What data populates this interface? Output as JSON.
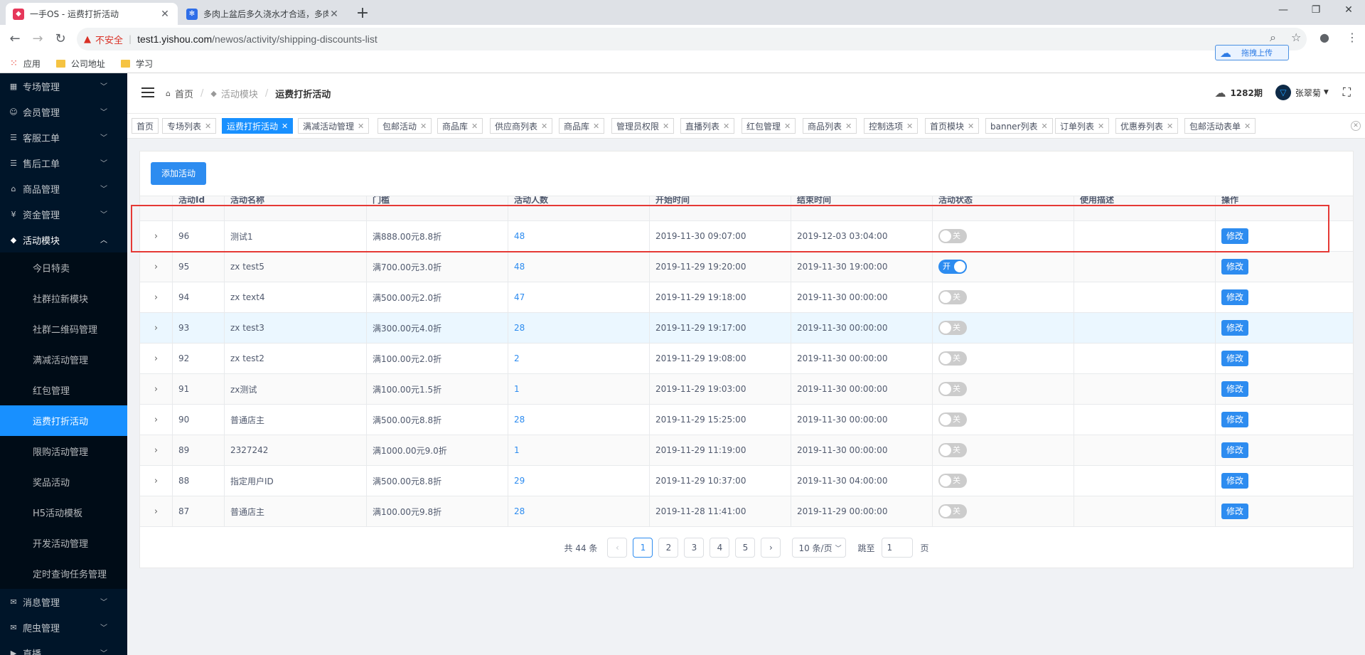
{
  "browser": {
    "tabs": [
      {
        "title": "一手OS - 运费打折活动",
        "active": true
      },
      {
        "title": "多肉上盆后多久浇水才合适，多肉",
        "active": false
      }
    ],
    "new_tab": "+",
    "controls": {
      "minimize": "—",
      "restore": "❐",
      "close": "✕"
    },
    "insecure_label": "不安全",
    "url_host": "test1.yishou.com",
    "url_path": "/newos/activity/shipping-discounts-list",
    "upload_badge": "拖拽上传",
    "bookmarks": [
      {
        "label": "应用",
        "icon": "apps-icon"
      },
      {
        "label": "公司地址",
        "icon": "folder-icon"
      },
      {
        "label": "学习",
        "icon": "folder-icon"
      }
    ]
  },
  "sidebar": {
    "top_items": [
      {
        "label": "专场管理",
        "icon": "▦"
      },
      {
        "label": "会员管理",
        "icon": "☺"
      },
      {
        "label": "客服工单",
        "icon": "☰"
      },
      {
        "label": "售后工单",
        "icon": "☰"
      },
      {
        "label": "商品管理",
        "icon": "⌂"
      },
      {
        "label": "资金管理",
        "icon": "¥"
      },
      {
        "label": "活动模块",
        "icon": "◆"
      }
    ],
    "sub_items": [
      {
        "label": "今日特卖",
        "active": false
      },
      {
        "label": "社群拉新模块",
        "active": false
      },
      {
        "label": "社群二维码管理",
        "active": false
      },
      {
        "label": "满减活动管理",
        "active": false
      },
      {
        "label": "红包管理",
        "active": false
      },
      {
        "label": "运费打折活动",
        "active": true
      },
      {
        "label": "限购活动管理",
        "active": false
      },
      {
        "label": "奖品活动",
        "active": false
      },
      {
        "label": "H5活动模板",
        "active": false
      },
      {
        "label": "开发活动管理",
        "active": false
      },
      {
        "label": "定时查询任务管理",
        "active": false
      }
    ],
    "bottom_items": [
      {
        "label": "消息管理",
        "icon": "✉"
      },
      {
        "label": "爬虫管理",
        "icon": "✉"
      },
      {
        "label": "直播",
        "icon": "▶"
      }
    ]
  },
  "header": {
    "breadcrumb": [
      "首页",
      "活动模块",
      "运费打折活动"
    ],
    "periods": "1282期",
    "user": "张翠菊"
  },
  "tags": [
    {
      "label": "首页",
      "closable": false,
      "active": false
    },
    {
      "label": "专场列表",
      "closable": true,
      "active": false
    },
    {
      "label": "运费打折活动",
      "closable": true,
      "active": true
    },
    {
      "label": "满减活动管理",
      "closable": true,
      "active": false
    },
    {
      "label": "包邮活动",
      "closable": true,
      "active": false
    },
    {
      "label": "商品库",
      "closable": true,
      "active": false
    },
    {
      "label": "供应商列表",
      "closable": true,
      "active": false
    },
    {
      "label": "商品库",
      "closable": true,
      "active": false
    },
    {
      "label": "管理员权限",
      "closable": true,
      "active": false
    },
    {
      "label": "直播列表",
      "closable": true,
      "active": false
    },
    {
      "label": "红包管理",
      "closable": true,
      "active": false
    },
    {
      "label": "商品列表",
      "closable": true,
      "active": false
    },
    {
      "label": "控制选项",
      "closable": true,
      "active": false
    },
    {
      "label": "首页模块",
      "closable": true,
      "active": false
    },
    {
      "label": "banner列表",
      "closable": true,
      "active": false
    },
    {
      "label": "订单列表",
      "closable": true,
      "active": false
    },
    {
      "label": "优惠券列表",
      "closable": true,
      "active": false
    },
    {
      "label": "包邮活动表单",
      "closable": true,
      "active": false
    }
  ],
  "main": {
    "add_button": "添加活动",
    "columns": [
      "活动Id",
      "活动名称",
      "门槛",
      "活动人数",
      "开始时间",
      "结束时间",
      "活动状态",
      "使用描述",
      "操作"
    ],
    "rows": [
      {
        "id": "96",
        "name": "测试1",
        "threshold": "满888.00元8.8折",
        "participants": "48",
        "start": "2019-11-30 09:07:00",
        "end": "2019-12-03 03:04:00",
        "status": "关",
        "on": false,
        "desc": "",
        "action": "修改"
      },
      {
        "id": "95",
        "name": "zx test5",
        "threshold": "满700.00元3.0折",
        "participants": "48",
        "start": "2019-11-29 19:20:00",
        "end": "2019-11-30 19:00:00",
        "status": "开",
        "on": true,
        "desc": "",
        "action": "修改"
      },
      {
        "id": "94",
        "name": "zx text4",
        "threshold": "满500.00元2.0折",
        "participants": "47",
        "start": "2019-11-29 19:18:00",
        "end": "2019-11-30 00:00:00",
        "status": "关",
        "on": false,
        "desc": "",
        "action": "修改"
      },
      {
        "id": "93",
        "name": "zx test3",
        "threshold": "满300.00元4.0折",
        "participants": "28",
        "start": "2019-11-29 19:17:00",
        "end": "2019-11-30 00:00:00",
        "status": "关",
        "on": false,
        "desc": "",
        "action": "修改"
      },
      {
        "id": "92",
        "name": "zx test2",
        "threshold": "满100.00元2.0折",
        "participants": "2",
        "start": "2019-11-29 19:08:00",
        "end": "2019-11-30 00:00:00",
        "status": "关",
        "on": false,
        "desc": "",
        "action": "修改"
      },
      {
        "id": "91",
        "name": "zx测试",
        "threshold": "满100.00元1.5折",
        "participants": "1",
        "start": "2019-11-29 19:03:00",
        "end": "2019-11-30 00:00:00",
        "status": "关",
        "on": false,
        "desc": "",
        "action": "修改"
      },
      {
        "id": "90",
        "name": "普通店主",
        "threshold": "满500.00元8.8折",
        "participants": "28",
        "start": "2019-11-29 15:25:00",
        "end": "2019-11-30 00:00:00",
        "status": "关",
        "on": false,
        "desc": "",
        "action": "修改"
      },
      {
        "id": "89",
        "name": "2327242",
        "threshold": "满1000.00元9.0折",
        "participants": "1",
        "start": "2019-11-29 11:19:00",
        "end": "2019-11-30 00:00:00",
        "status": "关",
        "on": false,
        "desc": "",
        "action": "修改"
      },
      {
        "id": "88",
        "name": "指定用户ID",
        "threshold": "满500.00元8.8折",
        "participants": "29",
        "start": "2019-11-29 10:37:00",
        "end": "2019-11-30 04:00:00",
        "status": "关",
        "on": false,
        "desc": "",
        "action": "修改"
      },
      {
        "id": "87",
        "name": "普通店主",
        "threshold": "满100.00元9.8折",
        "participants": "28",
        "start": "2019-11-28 11:41:00",
        "end": "2019-11-29 00:00:00",
        "status": "关",
        "on": false,
        "desc": "",
        "action": "修改"
      }
    ],
    "pagination": {
      "total": "共 44 条",
      "prev": "‹",
      "next": "›",
      "pages": [
        "1",
        "2",
        "3",
        "4",
        "5"
      ],
      "current": "1",
      "page_size": "10 条/页",
      "jump_label": "跳至",
      "jump_value": "1",
      "jump_suffix": "页"
    }
  }
}
